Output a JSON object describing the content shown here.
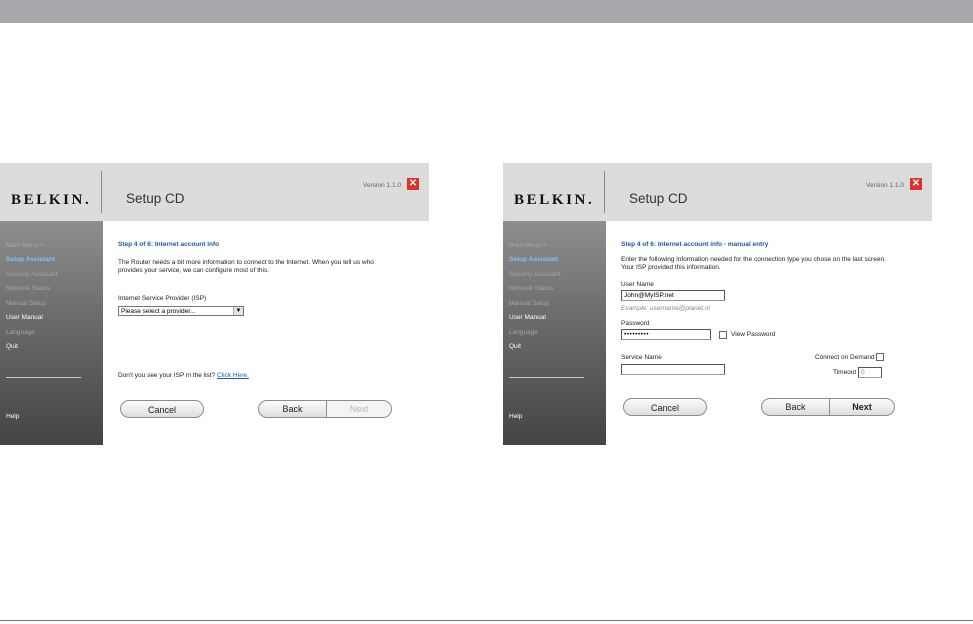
{
  "app": {
    "logo": "BELKIN.",
    "title": "Setup CD",
    "version": "Version 1.1.0",
    "close_glyph": "✕"
  },
  "sidebar": {
    "items": [
      {
        "label": "Main Menu  >"
      },
      {
        "label": "Setup Assistant"
      },
      {
        "label": "Security Assistant"
      },
      {
        "label": "Network Status"
      },
      {
        "label": "Manual Setup"
      },
      {
        "label": "User Manual"
      },
      {
        "label": "Language"
      },
      {
        "label": "Quit"
      }
    ],
    "help": "Help"
  },
  "screen_a": {
    "step": "Step 4 of 6: Internet account info",
    "desc_line1": "The Router needs a bit more information to connect to the Internet. When you tell us who",
    "desc_line2": "provides your service, we can configure most of this.",
    "isp_label": "Internet Service Provider (ISP)",
    "isp_select": "Please select a provider...",
    "isp_arrow": "▼",
    "not_listed": "Don't you see your ISP in the list?",
    "click_here": "Click Here.",
    "cancel": "Cancel",
    "back": "Back",
    "next": "Next"
  },
  "screen_b": {
    "step": "Step 4 of 6: Internet account info - manual entry",
    "desc_line1": "Enter the following information needed for the connection type you chose on the last screen.",
    "desc_line2": "Your ISP provided this information.",
    "username_label": "User Name",
    "username_value": "John@MyISP.net",
    "example": "Example: username@planet.nl",
    "password_label": "Password",
    "password_value": "•••••••••",
    "view_password": "View Password",
    "service_label": "Service Name",
    "service_value": "",
    "connect_demand": "Connect on Demand",
    "timeout_label": "Timeout",
    "timeout_value": "0",
    "cancel": "Cancel",
    "back": "Back",
    "next": "Next"
  }
}
